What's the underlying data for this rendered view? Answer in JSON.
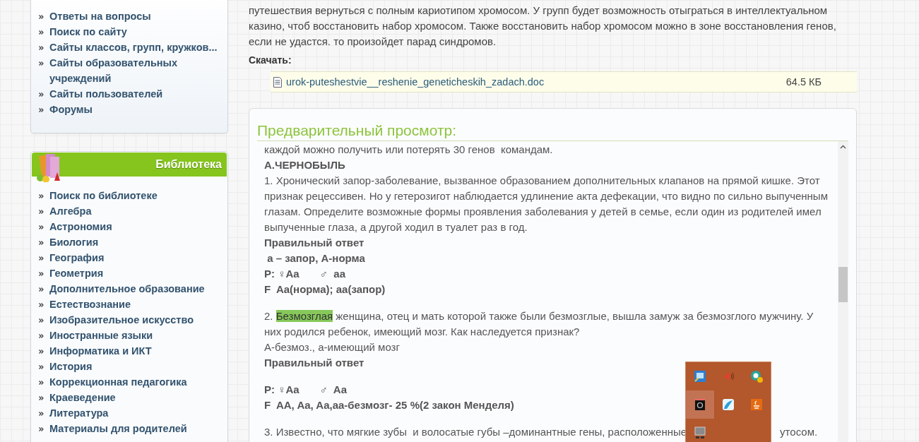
{
  "sidebar": {
    "menu": {
      "items": [
        {
          "label": "Ответы на вопросы"
        },
        {
          "label": "Поиск по сайту"
        },
        {
          "label": "Сайты классов, групп, кружков..."
        },
        {
          "label": "Сайты образовательных учреждений"
        },
        {
          "label": "Сайты пользователей"
        },
        {
          "label": "Форумы"
        }
      ]
    },
    "library": {
      "title": "Библиотека",
      "items": [
        {
          "label": "Поиск по библиотеке"
        },
        {
          "label": "Алгебра"
        },
        {
          "label": "Астрономия"
        },
        {
          "label": "Биология"
        },
        {
          "label": "География"
        },
        {
          "label": "Геометрия"
        },
        {
          "label": "Дополнительное образование"
        },
        {
          "label": "Естествознание"
        },
        {
          "label": "Изобразительное искусство"
        },
        {
          "label": "Иностранные языки"
        },
        {
          "label": "Информатика и ИКТ"
        },
        {
          "label": "История"
        },
        {
          "label": "Коррекционная педагогика"
        },
        {
          "label": "Краеведение"
        },
        {
          "label": "Литература"
        },
        {
          "label": "Материалы для родителей"
        }
      ]
    }
  },
  "intro_paragraph": "путешествия вернуться с полным кариотипом хромосом. У групп будет возможность отыграться в интеллектуальном казино,  чтоб восстановить набор хромосом. Также восстановить  набор хромосом можно в зоне восстановления генов, если не удастся. то произойдет парад синдромов.",
  "download": {
    "label": "Скачать:",
    "file": {
      "name": "urok-puteshestvie__reshenie_geneticheskih_zadach.doc",
      "size": "64.5 КБ"
    }
  },
  "preview": {
    "title": "Предварительный просмотр:",
    "blocks": [
      {
        "kind": "text",
        "text": "каждой можно получить или потерять 30 генов  командам."
      },
      {
        "kind": "bold",
        "text": "А.ЧЕРНОБЫЛЬ"
      },
      {
        "kind": "text",
        "text": "1. Хронический запор-заболевание, вызванное образованием дополнительных клапанов на прямой кишке. Этот признак рецессивен. Но у гетерозигот наблюдается удлинение акта дефекации, что видно по сильно выпученным глазам. Определите возможные формы проявления заболевания у детей в семье, если один из родителей имел выпученные глаза, а другой ходил в туалет раз в год."
      },
      {
        "kind": "bold",
        "text": "Правильный ответ"
      },
      {
        "kind": "bold",
        "text": " а – запор, А-норма"
      },
      {
        "kind": "bold",
        "text": "P: ♀Aa       ♂  aa"
      },
      {
        "kind": "bold",
        "text": "F  Aa(норма); aa(запор)"
      },
      {
        "kind": "parts",
        "space_before": true,
        "parts": [
          {
            "text": "2. ",
            "highlighted": false
          },
          {
            "text": "Безмозглая",
            "highlighted": true
          },
          {
            "text": " женщина, отец и мать которой также были безмозглые, вышла замуж за безмозглого мужчину. У них родился ребенок, имеющий мозг. Как наследуется признак?",
            "highlighted": false
          }
        ]
      },
      {
        "kind": "text",
        "text": "А-безмоз., а-имеющий мозг"
      },
      {
        "kind": "bold",
        "text": "Правильный ответ"
      },
      {
        "kind": "bold",
        "space_before": true,
        "text": "P: ♀Aa       ♂  Aa"
      },
      {
        "kind": "bold",
        "text": "F  AA, Aa, Aa,aa-безмозг- 25 %(2 закон Менделя)"
      },
      {
        "kind": "covered",
        "space_before": true,
        "text": "3. Известно, что мягкие зубы  и волосатые губы –доминантные гены, расположенные",
        "text_after": "утосом."
      }
    ]
  },
  "tray": {
    "icons": [
      {
        "kind": "screen",
        "selected": false
      },
      {
        "kind": "speaker",
        "selected": false
      },
      {
        "kind": "e-badge",
        "selected": false
      },
      {
        "kind": "camera",
        "selected": true
      },
      {
        "kind": "bird",
        "selected": false
      },
      {
        "kind": "cup",
        "selected": false
      },
      {
        "kind": "monitor",
        "selected": false
      }
    ]
  }
}
